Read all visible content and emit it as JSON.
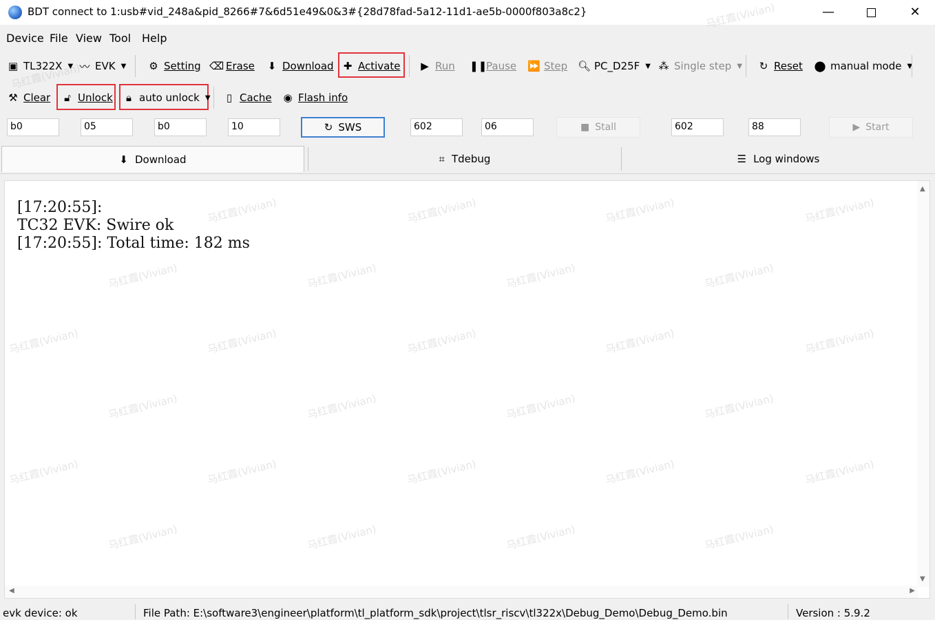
{
  "window": {
    "title": "BDT connect to 1:usb#vid_248a&pid_8266#7&6d51e49&0&3#{28d78fad-5a12-11d1-ae5b-0000f803a8c2}",
    "minimize": "—",
    "close": "✕"
  },
  "menu": [
    "Device",
    "File",
    "View",
    "Tool",
    "Help"
  ],
  "toolbar1": {
    "chip": "TL322X",
    "board": "EVK",
    "setting": "Setting",
    "erase": "Erase",
    "download": "Download",
    "activate": "Activate",
    "run": "Run",
    "pause": "Pause",
    "step": "Step",
    "pc": "PC_D25F",
    "single_step": "Single step",
    "reset": "Reset",
    "mode": "manual mode"
  },
  "toolbar2": {
    "clear": "Clear",
    "unlock": "Unlock",
    "auto_unlock": "auto unlock",
    "cache": "Cache",
    "flash_info": "Flash info"
  },
  "fields": {
    "f1": "b0",
    "f2": "05",
    "f3": "b0",
    "f4": "10",
    "sws": "SWS",
    "f5": "602",
    "f6": "06",
    "stall": "Stall",
    "f7": "602",
    "f8": "88",
    "start": "Start"
  },
  "tabs": [
    "Download",
    "Tdebug",
    "Log windows"
  ],
  "log": {
    "line1": "[17:20:55]:",
    "line2": "TC32 EVK: Swire ok",
    "line3": "[17:20:55]: Total time: 182 ms"
  },
  "status": {
    "device": "evk device: ok",
    "file_path": "File Path:  E:\\software3\\engineer\\platform\\tl_platform_sdk\\project\\tlsr_riscv\\tl322x\\Debug_Demo\\Debug_Demo.bin",
    "version": "Version : 5.9.2"
  },
  "watermark": "马红霞(Vivian)",
  "colors": {
    "highlight": "#e0333c",
    "focus": "#3c7fd0"
  }
}
